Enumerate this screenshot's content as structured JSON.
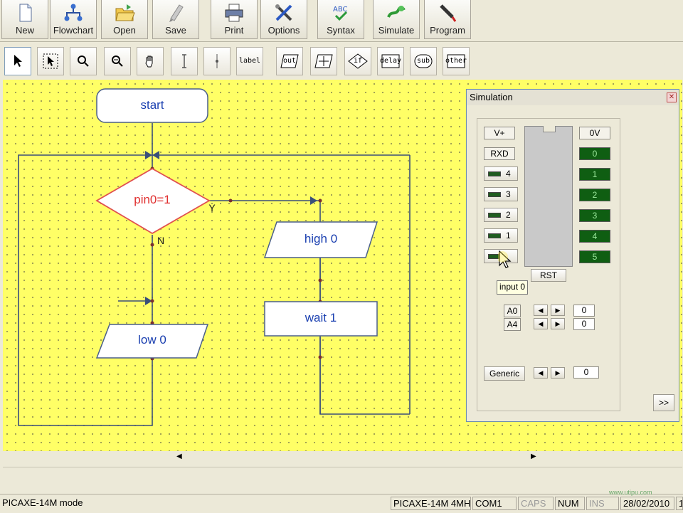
{
  "toolbar": {
    "buttons": [
      {
        "label": "New",
        "icon": "new-file-icon"
      },
      {
        "label": "Flowchart",
        "icon": "flowchart-icon"
      },
      {
        "label": "Open",
        "icon": "open-folder-icon"
      },
      {
        "label": "Save",
        "icon": "save-icon"
      },
      {
        "label": "Print",
        "icon": "printer-icon"
      },
      {
        "label": "Options",
        "icon": "tools-icon"
      },
      {
        "label": "Syntax",
        "icon": "syntax-check-icon"
      },
      {
        "label": "Simulate",
        "icon": "simulate-icon"
      },
      {
        "label": "Program",
        "icon": "program-icon"
      }
    ]
  },
  "palette": {
    "label_tool": "label",
    "out": "out",
    "if": "if",
    "delay": "delay",
    "sub": "sub",
    "other": "other"
  },
  "flowchart": {
    "start": "start",
    "decision": "pin0=1",
    "yes": "Y",
    "no": "N",
    "high": "high 0",
    "wait": "wait 1",
    "low": "low 0",
    "colors": {
      "canvas": "#FFFF66",
      "node_text": "#1a3fb0",
      "decision_text": "#E03030",
      "decision_border": "#E05050"
    }
  },
  "simulation": {
    "title": "Simulation",
    "vplus": "V+",
    "rxd": "RXD",
    "zero_v": "0V",
    "inputs": [
      "4",
      "3",
      "2",
      "1",
      ""
    ],
    "outputs": [
      "0",
      "1",
      "2",
      "3",
      "4",
      "5"
    ],
    "rst": "RST",
    "tooltip": "input 0",
    "analog": [
      {
        "label": "A0",
        "value": "0"
      },
      {
        "label": "A4",
        "value": "0"
      }
    ],
    "generic": {
      "label": "Generic",
      "value": "0"
    },
    "expand": ">>"
  },
  "status": {
    "mode": "PICAXE-14M mode",
    "chip": "PICAXE-14M 4MH",
    "port": "COM1",
    "caps": "CAPS",
    "num": "NUM",
    "ins": "INS",
    "date": "28/02/2010",
    "extra": "1",
    "watermark": "www.utipu.com"
  }
}
